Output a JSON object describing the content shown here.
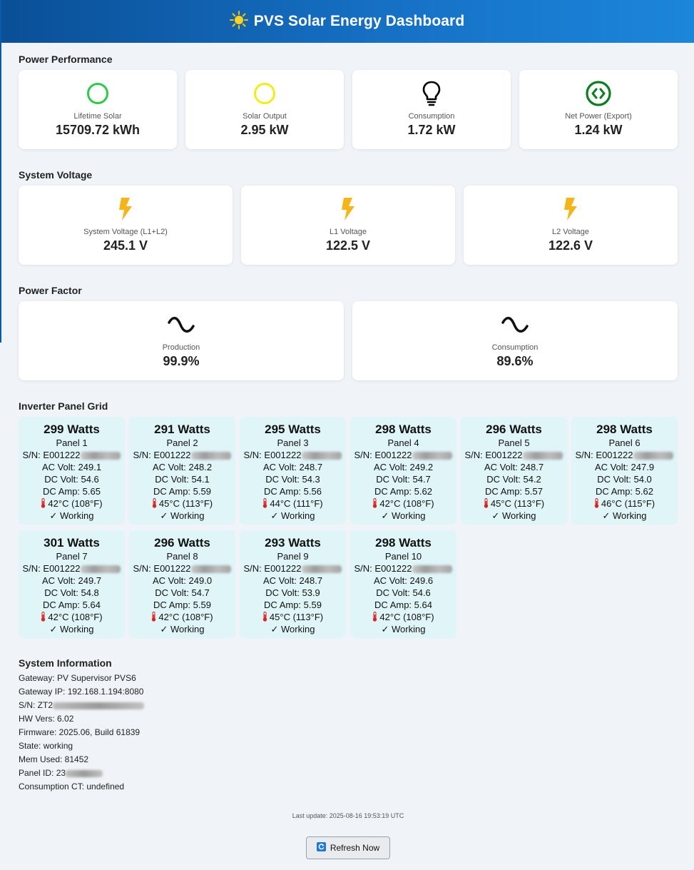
{
  "header": {
    "title": "PVS Solar Energy Dashboard",
    "icon": "sun-icon"
  },
  "power_performance": {
    "title": "Power Performance",
    "cards": [
      {
        "label": "Lifetime Solar",
        "value": "15709.72 kWh",
        "icon": "green-circle-icon",
        "color": "#2ec94a"
      },
      {
        "label": "Solar Output",
        "value": "2.95 kW",
        "icon": "yellow-circle-icon",
        "color": "#f2ec19"
      },
      {
        "label": "Consumption",
        "value": "1.72 kW",
        "icon": "lightbulb-icon",
        "color": "#000000"
      },
      {
        "label": "Net Power (Export)",
        "value": "1.24 kW",
        "icon": "export-arrows-icon",
        "color": "#0d7d22"
      }
    ]
  },
  "system_voltage": {
    "title": "System Voltage",
    "cards": [
      {
        "label": "System Voltage (L1+L2)",
        "value": "245.1 V",
        "icon": "lightning-icon"
      },
      {
        "label": "L1 Voltage",
        "value": "122.5 V",
        "icon": "lightning-icon"
      },
      {
        "label": "L2 Voltage",
        "value": "122.6 V",
        "icon": "lightning-icon"
      }
    ],
    "color": "#f5b418"
  },
  "power_factor": {
    "title": "Power Factor",
    "cards": [
      {
        "label": "Production",
        "value": "99.9%",
        "icon": "sine-wave-icon"
      },
      {
        "label": "Consumption",
        "value": "89.6%",
        "icon": "sine-wave-icon"
      }
    ]
  },
  "inverter_grid": {
    "title": "Inverter Panel Grid",
    "panels": [
      {
        "watts": "299 Watts",
        "name": "Panel 1",
        "sn": "S/N: E001222",
        "ac": "AC Volt: 249.1",
        "dc_volt": "DC Volt: 54.6",
        "dc_amp": "DC Amp: 5.65",
        "temp": "42°C (108°F)",
        "status": "✓ Working"
      },
      {
        "watts": "291 Watts",
        "name": "Panel 2",
        "sn": "S/N: E001222",
        "ac": "AC Volt: 248.2",
        "dc_volt": "DC Volt: 54.1",
        "dc_amp": "DC Amp: 5.59",
        "temp": "45°C (113°F)",
        "status": "✓ Working"
      },
      {
        "watts": "295 Watts",
        "name": "Panel 3",
        "sn": "S/N: E001222",
        "ac": "AC Volt: 248.7",
        "dc_volt": "DC Volt: 54.3",
        "dc_amp": "DC Amp: 5.56",
        "temp": "44°C (111°F)",
        "status": "✓ Working"
      },
      {
        "watts": "298 Watts",
        "name": "Panel 4",
        "sn": "S/N: E001222",
        "ac": "AC Volt: 249.2",
        "dc_volt": "DC Volt: 54.7",
        "dc_amp": "DC Amp: 5.62",
        "temp": "42°C (108°F)",
        "status": "✓ Working"
      },
      {
        "watts": "296 Watts",
        "name": "Panel 5",
        "sn": "S/N: E001222",
        "ac": "AC Volt: 248.7",
        "dc_volt": "DC Volt: 54.2",
        "dc_amp": "DC Amp: 5.57",
        "temp": "45°C (113°F)",
        "status": "✓ Working"
      },
      {
        "watts": "298 Watts",
        "name": "Panel 6",
        "sn": "S/N: E001222",
        "ac": "AC Volt: 247.9",
        "dc_volt": "DC Volt: 54.0",
        "dc_amp": "DC Amp: 5.62",
        "temp": "46°C (115°F)",
        "status": "✓ Working"
      },
      {
        "watts": "301 Watts",
        "name": "Panel 7",
        "sn": "S/N: E001222",
        "ac": "AC Volt: 249.7",
        "dc_volt": "DC Volt: 54.8",
        "dc_amp": "DC Amp: 5.64",
        "temp": "42°C (108°F)",
        "status": "✓ Working"
      },
      {
        "watts": "296 Watts",
        "name": "Panel 8",
        "sn": "S/N: E001222",
        "ac": "AC Volt: 249.0",
        "dc_volt": "DC Volt: 54.7",
        "dc_amp": "DC Amp: 5.59",
        "temp": "42°C (108°F)",
        "status": "✓ Working"
      },
      {
        "watts": "293 Watts",
        "name": "Panel 9",
        "sn": "S/N: E001222",
        "ac": "AC Volt: 248.7",
        "dc_volt": "DC Volt: 53.9",
        "dc_amp": "DC Amp: 5.59",
        "temp": "45°C (113°F)",
        "status": "✓ Working"
      },
      {
        "watts": "298 Watts",
        "name": "Panel 10",
        "sn": "S/N: E001222",
        "ac": "AC Volt: 249.6",
        "dc_volt": "DC Volt: 54.6",
        "dc_amp": "DC Amp: 5.64",
        "temp": "42°C (108°F)",
        "status": "✓ Working"
      }
    ]
  },
  "system_info": {
    "title": "System Information",
    "lines": [
      "Gateway: PV Supervisor PVS6",
      "Gateway IP: 192.168.1.194:8080",
      "S/N: ZT2",
      "HW Vers: 6.02",
      "Firmware: 2025.06, Build 61839",
      "State: working",
      "Mem Used: 81452",
      "Panel ID: 23",
      "Consumption CT: undefined"
    ]
  },
  "footer": {
    "last_update": "Last update: 2025-08-16 19:53:19 UTC",
    "refresh_label": "Refresh Now"
  }
}
